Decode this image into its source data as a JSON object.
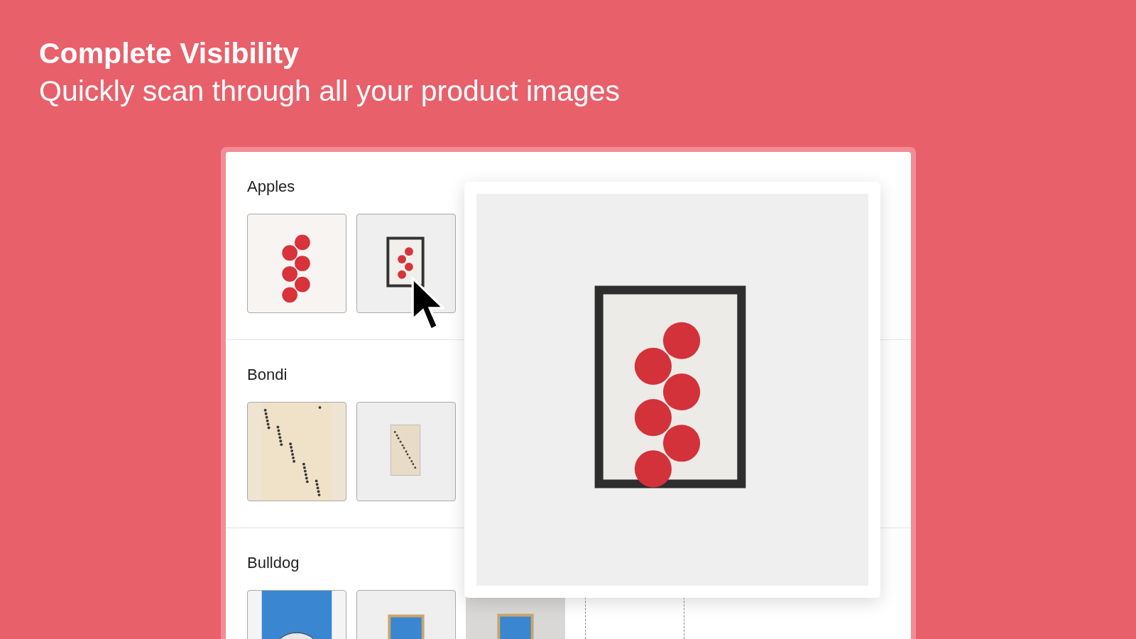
{
  "title": "Complete Visibility",
  "subtitle": "Quickly scan through all your product images",
  "products": [
    {
      "name": "Apples",
      "images": [
        {
          "kind": "apples-print"
        },
        {
          "kind": "apples-framed"
        }
      ]
    },
    {
      "name": "Bondi",
      "images": [
        {
          "kind": "beach-print"
        },
        {
          "kind": "beach-canvas"
        }
      ]
    },
    {
      "name": "Bulldog",
      "images": [
        {
          "kind": "dog-print"
        },
        {
          "kind": "dog-framed"
        },
        {
          "kind": "dog-wall"
        },
        {
          "kind": "add"
        }
      ]
    }
  ]
}
